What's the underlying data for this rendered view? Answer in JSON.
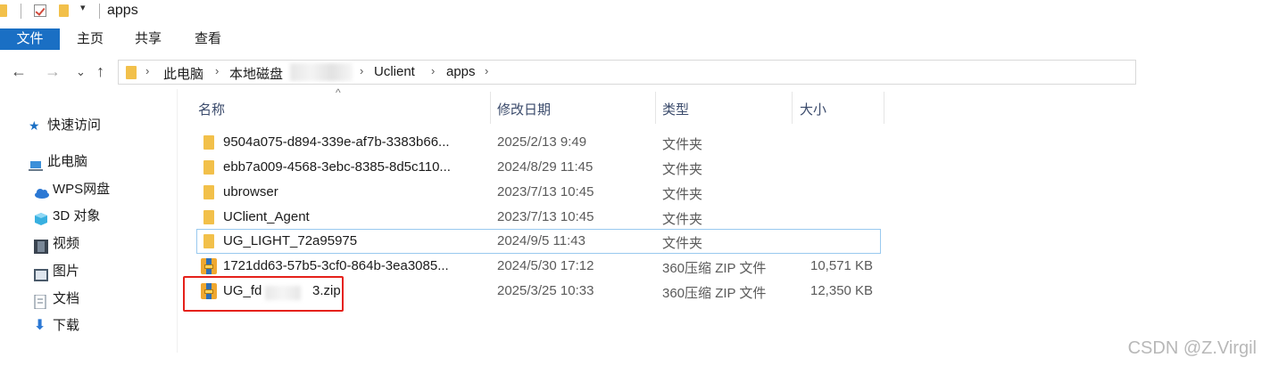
{
  "window": {
    "title": "apps"
  },
  "ribbon": {
    "tabs": [
      "文件",
      "主页",
      "共享",
      "查看"
    ]
  },
  "navigation": {
    "back_icon": "arrow-left-icon",
    "forward_icon": "arrow-right-icon",
    "recent_icon": "chevron-down-icon",
    "up_icon": "arrow-up-icon"
  },
  "address": {
    "crumbs": [
      "此电脑",
      "本地磁盘",
      "Uclient",
      "apps"
    ]
  },
  "sidebar": {
    "items": [
      {
        "label": "快速访问",
        "icon": "star-icon"
      },
      {
        "label": "此电脑",
        "icon": "computer-icon"
      },
      {
        "label": "WPS网盘",
        "icon": "cloud-icon"
      },
      {
        "label": "3D 对象",
        "icon": "cube-icon"
      },
      {
        "label": "视频",
        "icon": "film-icon"
      },
      {
        "label": "图片",
        "icon": "picture-icon"
      },
      {
        "label": "文档",
        "icon": "document-icon"
      },
      {
        "label": "下载",
        "icon": "download-icon"
      }
    ]
  },
  "columns": {
    "name": "名称",
    "date": "修改日期",
    "type": "类型",
    "size": "大小"
  },
  "files": [
    {
      "name": "9504a075-d894-339e-af7b-3383b66...",
      "date": "2025/2/13 9:49",
      "type": "文件夹",
      "size": "",
      "icon": "folder-icon"
    },
    {
      "name": "ebb7a009-4568-3ebc-8385-8d5c110...",
      "date": "2024/8/29 11:45",
      "type": "文件夹",
      "size": "",
      "icon": "folder-icon"
    },
    {
      "name": "ubrowser",
      "date": "2023/7/13 10:45",
      "type": "文件夹",
      "size": "",
      "icon": "folder-icon"
    },
    {
      "name": "UClient_Agent",
      "date": "2023/7/13 10:45",
      "type": "文件夹",
      "size": "",
      "icon": "folder-icon"
    },
    {
      "name": "UG_LIGHT_72a95975",
      "date": "2024/9/5 11:43",
      "type": "文件夹",
      "size": "",
      "icon": "folder-icon"
    },
    {
      "name": "1721dd63-57b5-3cf0-864b-3ea3085...",
      "date": "2024/5/30 17:12",
      "type": "360压缩 ZIP 文件",
      "size": "10,571 KB",
      "icon": "zip-archive-icon"
    },
    {
      "name": "UG_fd",
      "name_suffix": "3.zip",
      "date": "2025/3/25 10:33",
      "type": "360压缩 ZIP 文件",
      "size": "12,350 KB",
      "icon": "zip-archive-icon"
    }
  ],
  "watermark": "CSDN @Z.Virgil",
  "colors": {
    "accent": "#1a6fc4",
    "highlight_box": "#e5211a",
    "selection_border": "#99c9ef",
    "folder": "#f2c04a"
  }
}
